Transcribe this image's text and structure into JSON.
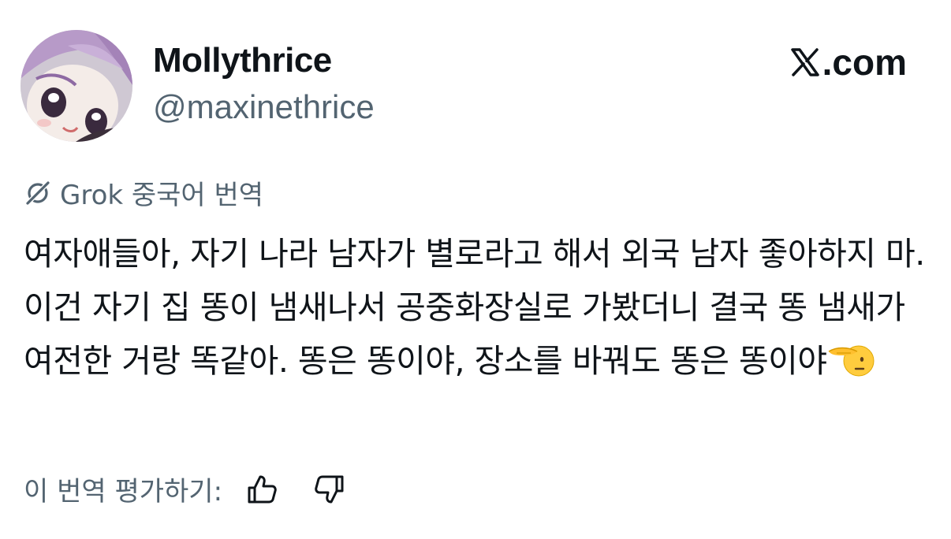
{
  "author": {
    "display_name": "Mollythrice",
    "handle": "@maxinethrice"
  },
  "brand": {
    "label": ".com",
    "icon": "x-logo-icon"
  },
  "translation": {
    "label": "Grok 중국어 번역",
    "icon": "grok-icon"
  },
  "post": {
    "text": "여자애들아, 자기 나라 남자가 별로라고 해서 외국 남자 좋아하지 마. 이건 자기 집 똥이 냄새나서 공중화장실로 가봤더니 결국 똥 냄새가 여전한 거랑 똑같아. 똥은 똥이야, 장소를 바꿔도 똥은 똥이야",
    "emoji": "saluting-face-emoji"
  },
  "rating": {
    "label": "이 번역 평가하기:",
    "up_icon": "thumbs-up-icon",
    "down_icon": "thumbs-down-icon"
  },
  "colors": {
    "text_primary": "#0f1419",
    "text_secondary": "#536471",
    "background": "#ffffff"
  }
}
